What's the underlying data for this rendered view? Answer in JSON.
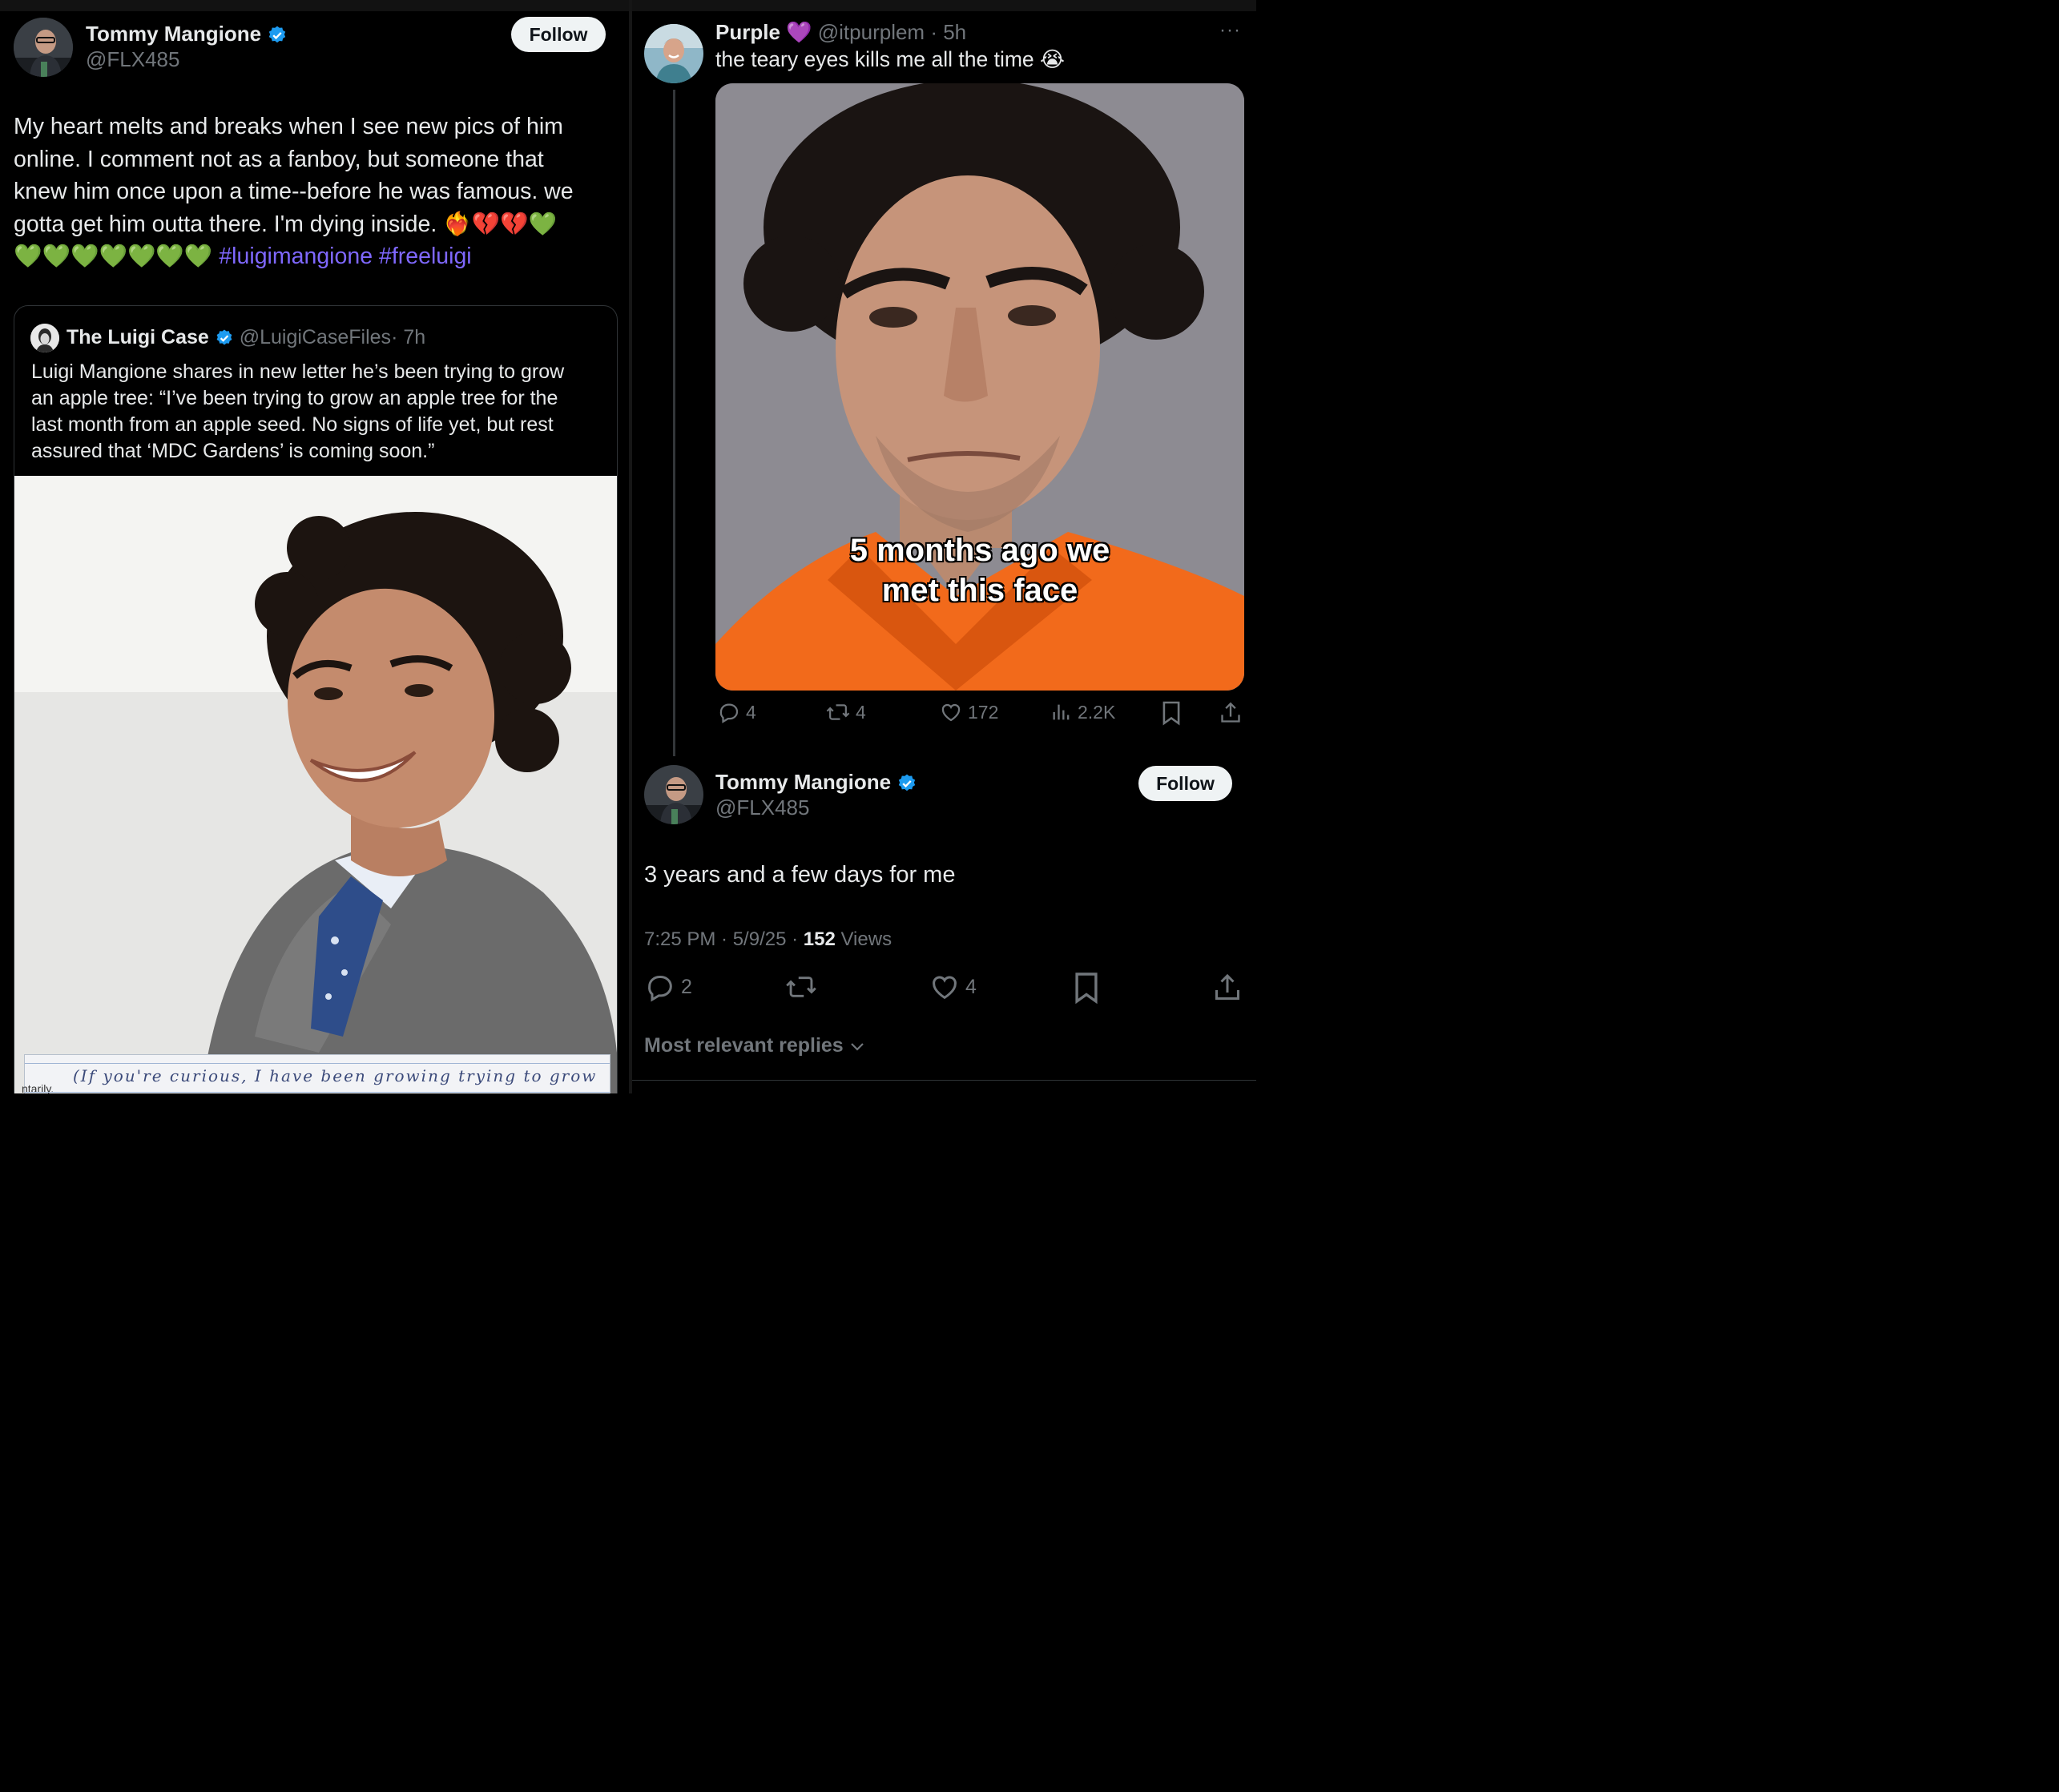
{
  "left_tweet": {
    "author_name": "Tommy Mangione",
    "author_handle": "@FLX485",
    "follow_label": "Follow",
    "text_line1": "My heart melts and breaks when I see new pics of him",
    "text_line2": "online.  I comment not as a fanboy, but someone that",
    "text_line3": "knew him once upon a time--before he was famous.  we",
    "text_line4": "gotta get him outta there.  I'm dying inside.",
    "line4_emoji": "❤️‍🔥💔💔💚",
    "line5_emoji": "💚💚💚💚💚💚💚",
    "hashtag1": "#luigimangione",
    "hashtag2": "#freeluigi",
    "quote": {
      "author_name": "The Luigi Case",
      "author_handle": "@LuigiCaseFiles",
      "time": "· 7h",
      "line1": "Luigi Mangione shares in new letter he’s been trying to grow",
      "line2": "an apple tree: “I’ve been trying to grow an apple tree for the",
      "line3": "last month from an apple seed. No signs of life yet, but rest",
      "line4": "assured that ‘MDC Gardens’ is coming soon.”",
      "letter_side_text": "ntarily.",
      "letter_handwriting": "(If you're curious, I have been growing trying to grow"
    }
  },
  "right_thread": {
    "parent": {
      "author_name": "Purple",
      "author_emoji": "💜",
      "author_handle": "@itpurplem",
      "time": "· 5h",
      "more_label": "···",
      "text": "the teary eyes kills me all the time",
      "text_emoji": "😭",
      "image_caption_line1": "5 months ago we",
      "image_caption_line2": "met this face",
      "replies": "4",
      "reposts": "4",
      "likes": "172",
      "views": "2.2K"
    },
    "reply": {
      "author_name": "Tommy Mangione",
      "author_handle": "@FLX485",
      "follow_label": "Follow",
      "text": "3 years and a few days for me",
      "time_date": "7:25 PM · 5/9/25 · ",
      "views_count": "152",
      "views_label": " Views",
      "replies": "2",
      "likes": "4"
    },
    "sort_label": "Most relevant replies"
  },
  "colors": {
    "background": "#000000",
    "text": "#e7e9ea",
    "muted": "#71767b",
    "hashtag": "#7f68ff",
    "verified": "#1d9bf0",
    "jumpsuit": "#f26a1b"
  }
}
